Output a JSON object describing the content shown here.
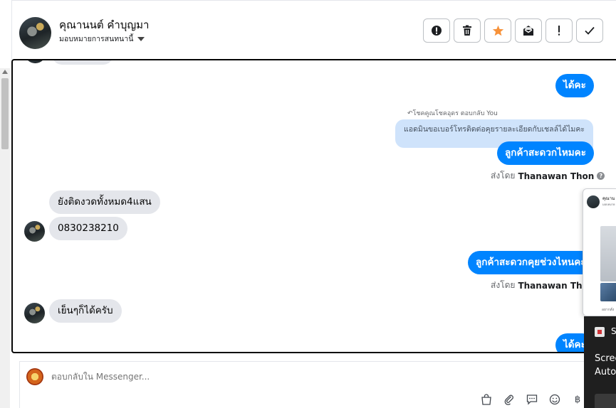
{
  "header": {
    "contact_name": "คุณานนต์ คำบุญมา",
    "assign_label": "มอบหมายการสนทนานี้",
    "actions": [
      {
        "icon": "alert-circle-icon"
      },
      {
        "icon": "trash-icon"
      },
      {
        "icon": "star-icon",
        "color": "#f7923a"
      },
      {
        "icon": "mark-unread-icon"
      },
      {
        "icon": "exclamation-icon"
      },
      {
        "icon": "check-icon"
      }
    ]
  },
  "messages": {
    "m1": "ได้คะ",
    "reply_hint": "โชคคูณโชคอุดร ตอบกลับ You",
    "reply_quote": "แอดมินขอเบอร์โทรติดต่อคุยรายละเอียดกับเชลล์ได้ไมคะ",
    "m2": "ลูกค้าสะดวกไหมคะ",
    "sent_by_1_prefix": "ส่งโดย",
    "sent_by_1_name": "Thanawan Thon",
    "m3": "ยังติดงวดทั้งหมด4แสน",
    "m4": "0830238210",
    "m5": "ลูกค้าสะดวกคุยช่วงไหนคะ",
    "sent_by_2_prefix": "ส่งโดย",
    "sent_by_2_name": "Thanawan Thon",
    "m6": "เย็นๆก็ได้ครับ",
    "m7": "ได้คะ"
  },
  "composer": {
    "placeholder": "ตอบกลับใน Messenger..."
  },
  "side_panel": {
    "name": "คุณาน",
    "caption": "อยากสั่ง"
  },
  "toast": {
    "letter": "S",
    "line1": "Scree",
    "line2": "Auto"
  },
  "colors": {
    "outgoing_bubble": "#0084ff",
    "incoming_bubble": "#e4e6eb",
    "reply_quote_bg": "#cfe3fb",
    "star": "#f7923a"
  }
}
